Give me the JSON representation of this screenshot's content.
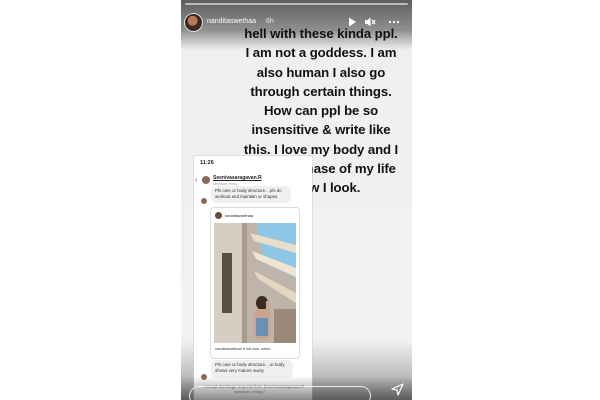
{
  "story": {
    "username": "nanditaswethaa",
    "time": "6h",
    "caption_lines": [
      "hell with these kinda ppl.",
      "I am not a goddess. I am",
      "also human I also go",
      "through certain things.",
      "How can ppl be so",
      "insensitive & write like",
      "this. I love my body and I",
      "like this phase of my life",
      "n how I look."
    ]
  },
  "screenshot": {
    "status_time": "11:26",
    "dm_name": "Seenivasaragavan.R",
    "dm_handle": "seenivas_reddy",
    "message1": "Pls care ur body structure... pls do workout and maintain ur shapes",
    "post_user": "nanditaswethaa",
    "post_caption": "nanditaswethaa If not now, when...",
    "message2": "Pls care ur body structure... ur body shows very mature aunty",
    "accept_line": "Accept message request from Seenivasaragavan.R",
    "accept_handle": "(seenivas_reddy)?"
  },
  "icons": {
    "play": "play-icon",
    "mute": "mute-icon",
    "more": "more-icon",
    "send": "send-icon"
  }
}
